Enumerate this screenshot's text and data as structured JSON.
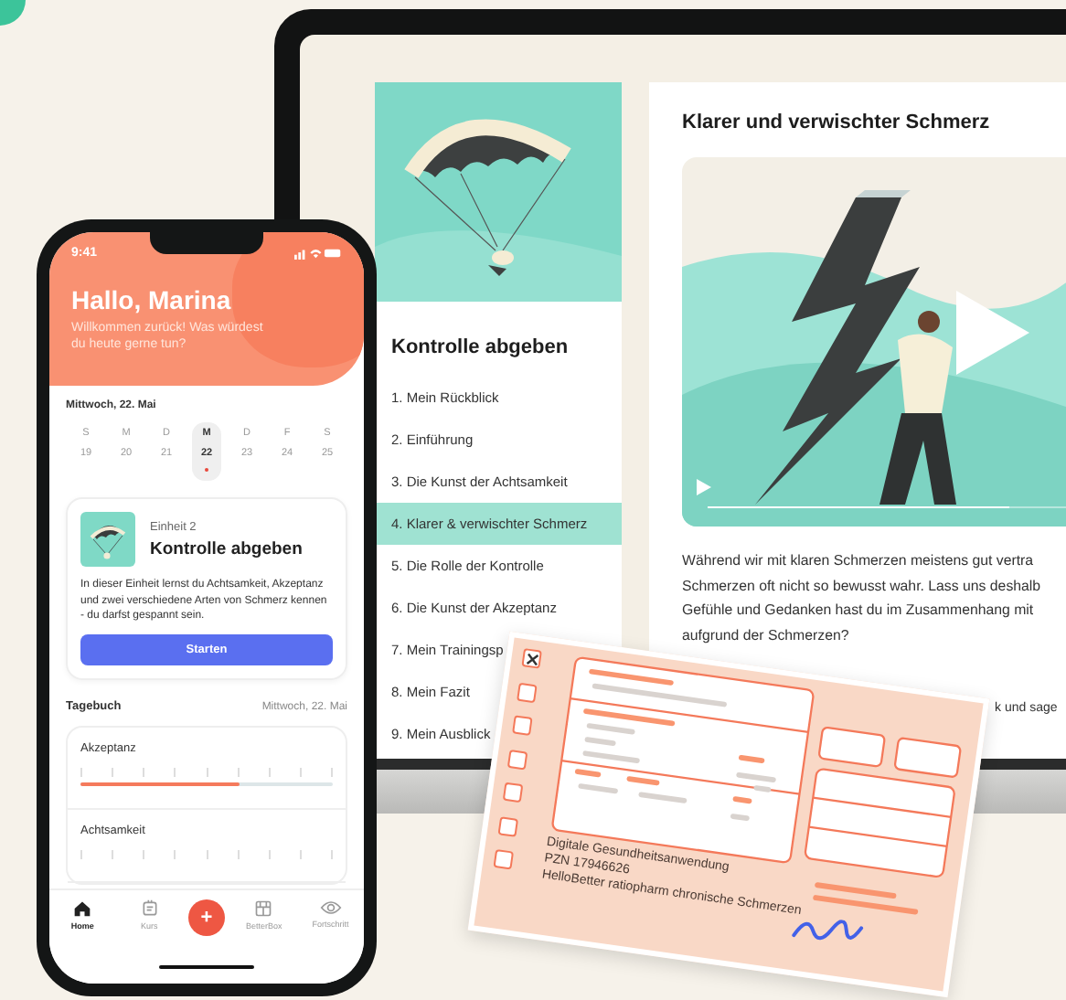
{
  "phone": {
    "status_time": "9:41",
    "greeting": "Hallo, Marina",
    "subtitle": "Willkommen zurück! Was würdest du heute gerne tun?",
    "date": "Mittwoch, 22. Mai",
    "week": [
      {
        "day": "S",
        "date": "19",
        "selected": false
      },
      {
        "day": "M",
        "date": "20",
        "selected": false
      },
      {
        "day": "D",
        "date": "21",
        "selected": false
      },
      {
        "day": "M",
        "date": "22",
        "selected": true
      },
      {
        "day": "D",
        "date": "23",
        "selected": false
      },
      {
        "day": "F",
        "date": "24",
        "selected": false
      },
      {
        "day": "S",
        "date": "25",
        "selected": false
      }
    ],
    "unit_card": {
      "eyebrow": "Einheit 2",
      "title": "Kontrolle abgeben",
      "description": "In dieser Einheit lernst du Achtsamkeit, Akzeptanz und zwei verschiedene Arten von Schmerz kennen - du darfst gespannt sein.",
      "button": "Starten"
    },
    "diary": {
      "title": "Tagebuch",
      "date": "Mittwoch, 22. Mai",
      "scales": [
        {
          "label": "Akzeptanz",
          "level": 0.63
        },
        {
          "label": "Achtsamkeit"
        }
      ]
    },
    "tabs": [
      {
        "label": "Home",
        "selected": true
      },
      {
        "label": "Kurs",
        "selected": false
      },
      {
        "label": "BetterBox",
        "selected": false
      },
      {
        "label": "Fortschritt",
        "selected": false
      }
    ],
    "add_button": "+"
  },
  "laptop": {
    "course": {
      "title": "Kontrolle abgeben",
      "chapters": [
        {
          "label": "1. Mein Rückblick",
          "selected": false
        },
        {
          "label": "2. Einführung",
          "selected": false
        },
        {
          "label": "3. Die Kunst der Achtsamkeit",
          "selected": false
        },
        {
          "label": "4. Klarer & verwischter Schmerz",
          "selected": true
        },
        {
          "label": "5. Die Rolle der Kontrolle",
          "selected": false
        },
        {
          "label": "6. Die Kunst der Akzeptanz",
          "selected": false
        },
        {
          "label": "7. Mein Trainingsp",
          "selected": false
        },
        {
          "label": "8. Mein Fazit",
          "selected": false
        },
        {
          "label": "9. Mein Ausblick",
          "selected": false
        }
      ]
    },
    "lesson": {
      "title": "Klarer und verwischter Schmerz",
      "video": {
        "level": 0.8
      },
      "paragraph_lines": [
        "Während wir mit klaren Schmerzen meistens gut vertra",
        "Schmerzen oft nicht so bewusst wahr. Lass uns deshalb",
        "Gefühle und Gedanken hast du im Zusammenhang mit",
        "aufgrund der Schmerzen?"
      ],
      "cut_line": "k und sage"
    }
  },
  "prescription": {
    "checkboxes": [
      {
        "checked": true
      },
      {
        "checked": false
      },
      {
        "checked": false
      },
      {
        "checked": false
      },
      {
        "checked": false
      },
      {
        "checked": false
      },
      {
        "checked": false
      }
    ],
    "lines": [
      "Digitale Gesundheitsanwendung",
      "PZN 17946626",
      "HelloBetter ratiopharm chronische Schmerzen"
    ]
  }
}
